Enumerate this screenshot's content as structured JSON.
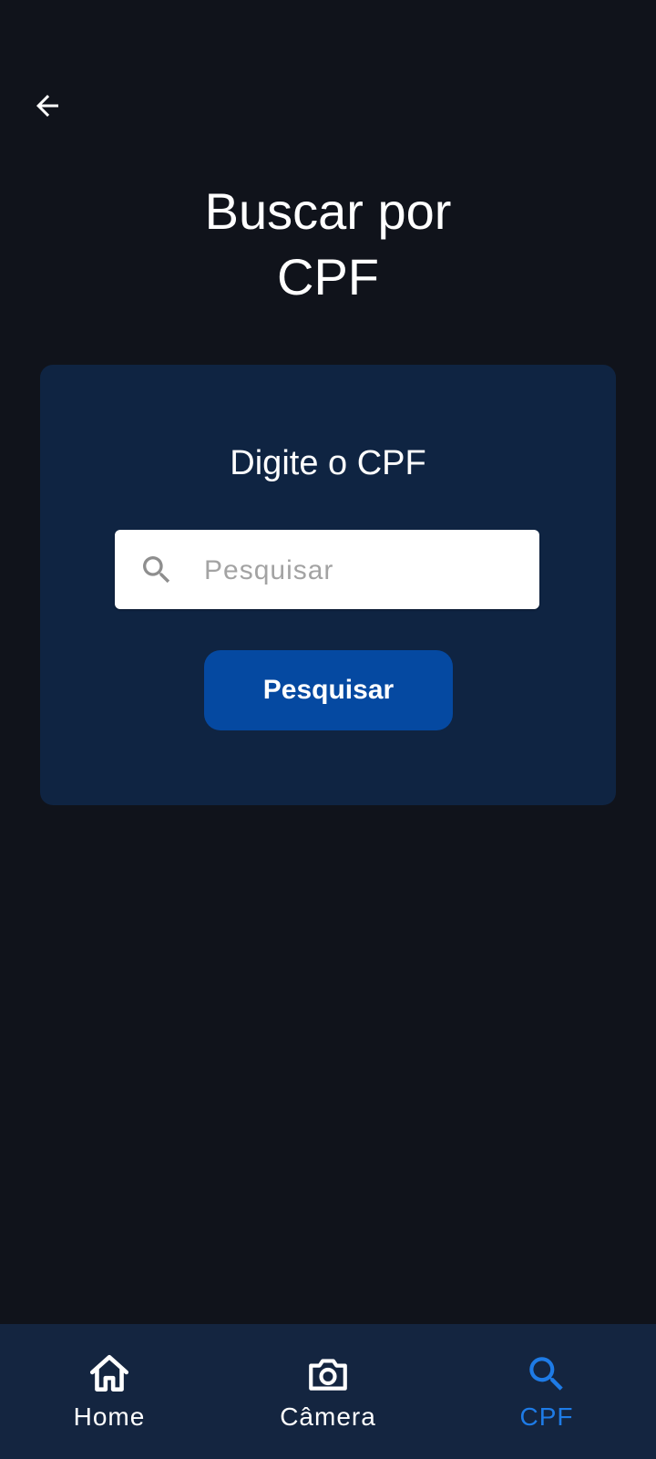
{
  "header": {
    "back_icon": "arrow-left-icon",
    "title_line1": "Buscar por",
    "title_line2": "CPF"
  },
  "card": {
    "heading": "Digite o CPF",
    "search": {
      "icon": "search-icon",
      "value": "",
      "placeholder": "Pesquisar"
    },
    "submit_label": "Pesquisar"
  },
  "bottom_nav": {
    "items": [
      {
        "label": "Home",
        "icon": "home-icon",
        "active": false
      },
      {
        "label": "Câmera",
        "icon": "camera-icon",
        "active": false
      },
      {
        "label": "CPF",
        "icon": "search-icon",
        "active": true
      }
    ]
  },
  "colors": {
    "background": "#10131b",
    "card": "#0f2442",
    "button": "#0549a1",
    "nav_background": "#142540",
    "accent": "#1e7be6",
    "text": "#ffffff",
    "placeholder": "#a3a3a3"
  }
}
